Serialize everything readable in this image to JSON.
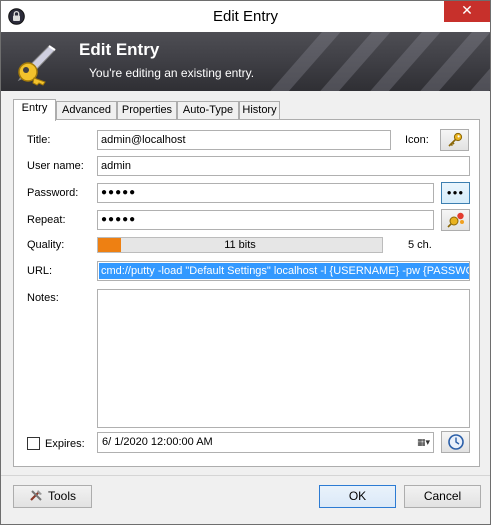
{
  "window": {
    "title": "Edit Entry",
    "close_glyph": "✕"
  },
  "banner": {
    "title": "Edit Entry",
    "subtitle": "You're editing an existing entry."
  },
  "tabs": [
    "Entry",
    "Advanced",
    "Properties",
    "Auto-Type",
    "History"
  ],
  "active_tab": "Entry",
  "form": {
    "title_label": "Title:",
    "title_value": "admin@localhost",
    "icon_label": "Icon:",
    "username_label": "User name:",
    "username_value": "admin",
    "password_label": "Password:",
    "password_value": "●●●●●",
    "reveal_glyph": "●●●",
    "repeat_label": "Repeat:",
    "repeat_value": "●●●●●",
    "quality_label": "Quality:",
    "quality_text": "11 bits",
    "quality_fraction": 0.08,
    "quality_chars": "5 ch.",
    "url_label": "URL:",
    "url_value": "cmd://putty -load \"Default Settings\" localhost -l {USERNAME} -pw {PASSWO",
    "notes_label": "Notes:",
    "notes_value": "",
    "expires_label": "Expires:",
    "expires_checked": false,
    "expires_value": "6/  1/2020 12:00:00 AM"
  },
  "buttons": {
    "tools": "Tools",
    "ok": "OK",
    "cancel": "Cancel"
  },
  "colors": {
    "quality_fill": "#ee8012",
    "selection": "#3399ff",
    "close": "#c7302b"
  }
}
